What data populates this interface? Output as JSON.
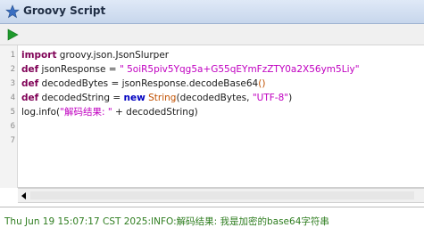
{
  "window": {
    "title": "Groovy Script",
    "title_icon": "star-icon"
  },
  "toolbar": {
    "run_icon": "play-icon"
  },
  "editor": {
    "lines": [
      {
        "num": "1",
        "tokens": [
          [
            "kw",
            "import"
          ],
          [
            "txt",
            " groovy.json.JsonSlurper"
          ]
        ]
      },
      {
        "num": "2",
        "tokens": [
          [
            "kw",
            "def"
          ],
          [
            "txt",
            " jsonResponse = "
          ],
          [
            "str",
            "\" 5oiR5piv5Yqg5a+G55qEYmFzZTY0a2X56ym5Liy\""
          ]
        ]
      },
      {
        "num": "3",
        "tokens": [
          [
            "kw",
            "def"
          ],
          [
            "txt",
            " decodedBytes = jsonResponse.decodeBase64"
          ],
          [
            "paren",
            "()"
          ]
        ]
      },
      {
        "num": "4",
        "tokens": [
          [
            "kw",
            "def"
          ],
          [
            "txt",
            " decodedString = "
          ],
          [
            "kw2",
            "new"
          ],
          [
            "txt",
            " "
          ],
          [
            "cls",
            "String"
          ],
          [
            "txt",
            "(decodedBytes, "
          ],
          [
            "str",
            "\"UTF-8\""
          ],
          [
            "txt",
            ")"
          ]
        ]
      },
      {
        "num": "5",
        "tokens": [
          [
            "txt",
            "log.info("
          ],
          [
            "str",
            "\"解码结果: \""
          ],
          [
            "txt",
            " + decodedString)"
          ]
        ]
      },
      {
        "num": "6",
        "tokens": []
      },
      {
        "num": "7",
        "tokens": []
      }
    ]
  },
  "output": {
    "text": "Thu Jun 19 15:07:17 CST 2025:INFO:解码结果: 我是加密的base64字符串"
  },
  "colors": {
    "keyword": "#7f0055",
    "string": "#c000c0",
    "output": "#2e7d1f"
  }
}
